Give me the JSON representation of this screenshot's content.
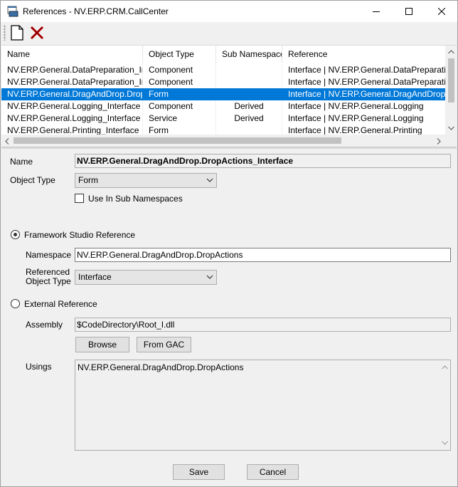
{
  "window": {
    "title": "References - NV.ERP.CRM.CallCenter",
    "icons": [
      "app-icon",
      "minimize-icon",
      "maximize-icon",
      "close-icon"
    ]
  },
  "toolbar": {
    "new_icon": "new-document-icon",
    "delete_icon": "delete-x-icon",
    "delete_color": "#c00000"
  },
  "grid": {
    "columns": [
      "Name",
      "Object Type",
      "Sub Namespace",
      "Reference"
    ],
    "rows": [
      {
        "name": "NV.ERP.General.DataPreparation_Int...",
        "type": "Component",
        "sub": "",
        "ref": "Interface | NV.ERP.General.DataPreparation"
      },
      {
        "name": "NV.ERP.General.DataPreparation_Int...",
        "type": "Component",
        "sub": "",
        "ref": "Interface | NV.ERP.General.DataPreparation"
      },
      {
        "name": "NV.ERP.General.DragAndDrop.DropA...",
        "type": "Form",
        "sub": "",
        "ref": "Interface | NV.ERP.General.DragAndDrop.Drop"
      },
      {
        "name": "NV.ERP.General.Logging_Interface",
        "type": "Component",
        "sub": "Derived",
        "ref": "Interface | NV.ERP.General.Logging"
      },
      {
        "name": "NV.ERP.General.Logging_Interface",
        "type": "Service",
        "sub": "Derived",
        "ref": "Interface | NV.ERP.General.Logging"
      },
      {
        "name": "NV.ERP.General.Printing_Interface",
        "type": "Form",
        "sub": "",
        "ref": "Interface | NV.ERP.General.Printing"
      }
    ],
    "selected_index": 2,
    "selection_color": "#0078d7"
  },
  "form": {
    "name_label": "Name",
    "name_value": "NV.ERP.General.DragAndDrop.DropActions_Interface",
    "object_type_label": "Object Type",
    "object_type_value": "Form",
    "use_sub_ns_label": "Use In Sub Namespaces",
    "framework_ref_label": "Framework Studio Reference",
    "namespace_label": "Namespace",
    "namespace_value": "NV.ERP.General.DragAndDrop.DropActions",
    "ref_obj_type_label_1": "Referenced",
    "ref_obj_type_label_2": "Object Type",
    "ref_obj_type_value": "Interface",
    "external_ref_label": "External Reference",
    "assembly_label": "Assembly",
    "assembly_value": "$CodeDirectory\\Root_I.dll",
    "browse_label": "Browse",
    "from_gac_label": "From GAC",
    "usings_label": "Usings",
    "usings_value": "NV.ERP.General.DragAndDrop.DropActions",
    "save_label": "Save",
    "cancel_label": "Cancel"
  }
}
